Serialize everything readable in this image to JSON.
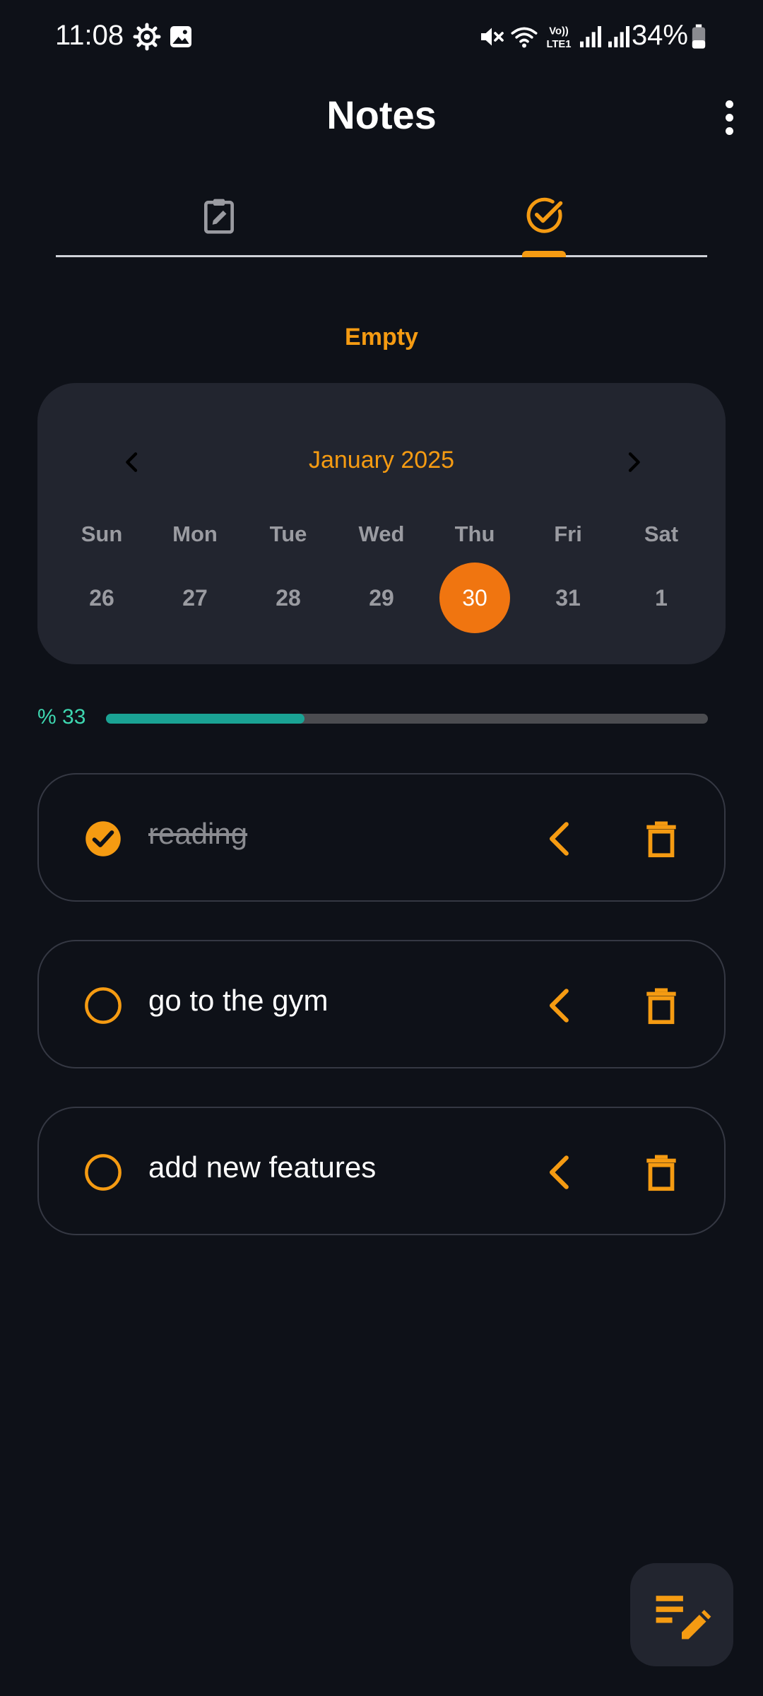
{
  "status_bar": {
    "time": "11:08",
    "battery": "34%",
    "icons": [
      "settings-icon",
      "gallery-icon",
      "mute-icon",
      "wifi-icon",
      "volte-icon",
      "signal-icon",
      "signal-icon",
      "battery-icon"
    ]
  },
  "header": {
    "title": "Notes",
    "menu_icon": "more-vert-icon"
  },
  "tabs": [
    {
      "icon": "clipboard-edit-icon",
      "active": false
    },
    {
      "icon": "check-circle-icon",
      "active": true
    }
  ],
  "empty_label": "Empty",
  "calendar": {
    "month": "January 2025",
    "weekdays": [
      "Sun",
      "Mon",
      "Tue",
      "Wed",
      "Thu",
      "Fri",
      "Sat"
    ],
    "days": [
      "26",
      "27",
      "28",
      "29",
      "30",
      "31",
      "1"
    ],
    "selected_day": "30"
  },
  "progress": {
    "label": "% 33",
    "fraction": 0.33
  },
  "tasks": [
    {
      "text": "reading",
      "done": true
    },
    {
      "text": "go to the gym",
      "done": false
    },
    {
      "text": "add new features",
      "done": false
    }
  ],
  "colors": {
    "background": "#0e1118",
    "card": "#22252f",
    "accent": "#f59b12",
    "selected_day": "#f07510",
    "progress": "#1aa394",
    "progress_label": "#3ed7b0"
  }
}
